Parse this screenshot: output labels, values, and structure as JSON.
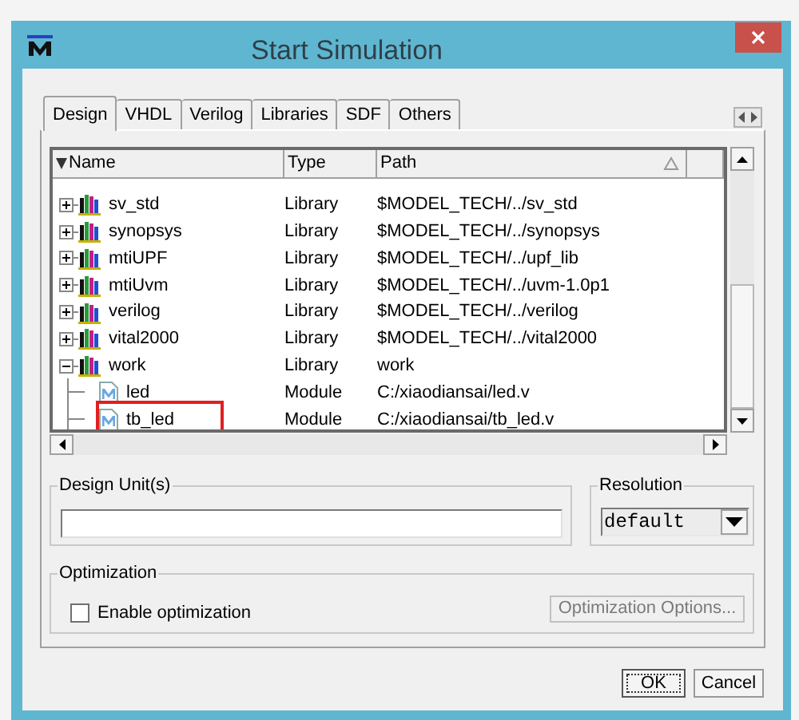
{
  "window": {
    "title": "Start Simulation"
  },
  "tabs": [
    {
      "label": "Design",
      "selected": true
    },
    {
      "label": "VHDL",
      "selected": false
    },
    {
      "label": "Verilog",
      "selected": false
    },
    {
      "label": "Libraries",
      "selected": false
    },
    {
      "label": "SDF",
      "selected": false
    },
    {
      "label": "Others",
      "selected": false
    }
  ],
  "table": {
    "columns": [
      {
        "label": "Name",
        "sorted": false
      },
      {
        "label": "Type",
        "sorted": false
      },
      {
        "label": "Path",
        "sorted": true
      }
    ],
    "rows": [
      {
        "kind": "library",
        "name": "sv_std",
        "type": "Library",
        "path": "$MODEL_TECH/../sv_std",
        "expanded": false
      },
      {
        "kind": "library",
        "name": "synopsys",
        "type": "Library",
        "path": "$MODEL_TECH/../synopsys",
        "expanded": false
      },
      {
        "kind": "library",
        "name": "mtiUPF",
        "type": "Library",
        "path": "$MODEL_TECH/../upf_lib",
        "expanded": false
      },
      {
        "kind": "library",
        "name": "mtiUvm",
        "type": "Library",
        "path": "$MODEL_TECH/../uvm-1.0p1",
        "expanded": false
      },
      {
        "kind": "library",
        "name": "verilog",
        "type": "Library",
        "path": "$MODEL_TECH/../verilog",
        "expanded": false
      },
      {
        "kind": "library",
        "name": "vital2000",
        "type": "Library",
        "path": "$MODEL_TECH/../vital2000",
        "expanded": false
      },
      {
        "kind": "library",
        "name": "work",
        "type": "Library",
        "path": "work",
        "expanded": true,
        "children": [
          {
            "kind": "module",
            "name": "led",
            "type": "Module",
            "path": "C:/xiaodiansai/led.v",
            "highlighted": false
          },
          {
            "kind": "module",
            "name": "tb_led",
            "type": "Module",
            "path": "C:/xiaodiansai/tb_led.v",
            "highlighted": true
          }
        ]
      }
    ]
  },
  "design_units": {
    "label": "Design Unit(s)"
  },
  "resolution": {
    "label": "Resolution",
    "value": "default"
  },
  "optimization": {
    "label": "Optimization",
    "checkbox": {
      "label": "Enable optimization",
      "checked": false
    },
    "options_button": {
      "label": "Optimization Options...",
      "disabled": true
    }
  },
  "buttons": [
    {
      "label": "OK",
      "focused": true
    },
    {
      "label": "Cancel",
      "focused": false
    }
  ]
}
